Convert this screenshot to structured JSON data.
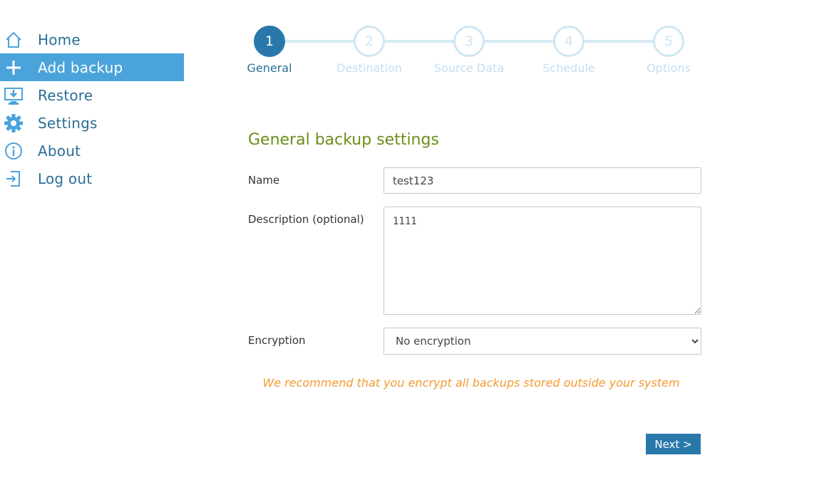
{
  "sidebar": {
    "items": [
      {
        "label": "Home",
        "icon": "home-icon"
      },
      {
        "label": "Add backup",
        "icon": "plus-icon",
        "active": true
      },
      {
        "label": "Restore",
        "icon": "restore-icon"
      },
      {
        "label": "Settings",
        "icon": "gear-icon"
      },
      {
        "label": "About",
        "icon": "info-icon"
      },
      {
        "label": "Log out",
        "icon": "logout-icon"
      }
    ]
  },
  "stepper": {
    "steps": [
      {
        "number": "1",
        "label": "General",
        "active": true
      },
      {
        "number": "2",
        "label": "Destination"
      },
      {
        "number": "3",
        "label": "Source Data"
      },
      {
        "number": "4",
        "label": "Schedule"
      },
      {
        "number": "5",
        "label": "Options"
      }
    ]
  },
  "form": {
    "title": "General backup settings",
    "name_label": "Name",
    "name_value": "test123",
    "description_label": "Description (optional)",
    "description_value": "1111",
    "encryption_label": "Encryption",
    "encryption_value": "No encryption",
    "warning": "We recommend that you encrypt all backups stored outside your system",
    "next_label": "Next >"
  },
  "colors": {
    "accent": "#2a78ab",
    "sidebar_active": "#4aa3db",
    "title_green": "#6a8f1a",
    "warning_orange": "#f39a30"
  }
}
